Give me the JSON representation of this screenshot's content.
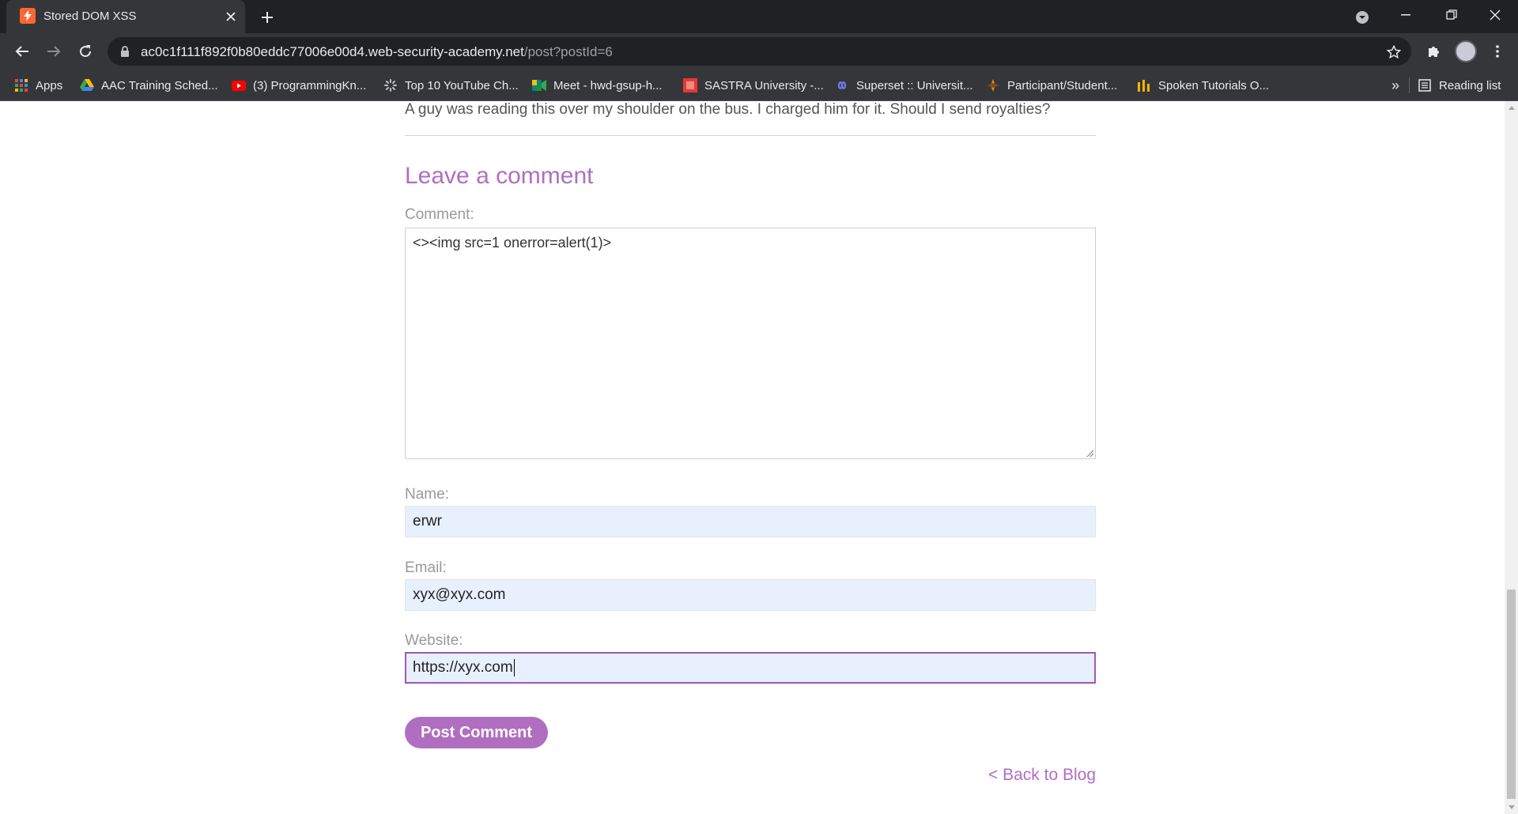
{
  "browser": {
    "tab": {
      "title": "Stored DOM XSS"
    },
    "url": {
      "host": "ac0c1f111f892f0b80eddc77006e00d4.web-security-academy.net",
      "path": "/post?postId=6"
    },
    "bookmarks": [
      {
        "label": "Apps",
        "icon": "apps-grid-icon"
      },
      {
        "label": "AAC Training Sched...",
        "icon": "google-drive-icon"
      },
      {
        "label": "(3) ProgrammingKn...",
        "icon": "youtube-icon"
      },
      {
        "label": "Top 10 YouTube Ch...",
        "icon": "loading-spinner-icon"
      },
      {
        "label": "Meet - hwd-gsup-h...",
        "icon": "google-meet-icon"
      },
      {
        "label": "SASTRA University -...",
        "icon": "sastra-icon"
      },
      {
        "label": "Superset :: Universit...",
        "icon": "superset-icon"
      },
      {
        "label": "Participant/Student...",
        "icon": "participant-icon"
      },
      {
        "label": "Spoken Tutorials O...",
        "icon": "spoken-tutorials-icon"
      }
    ],
    "overflow_label": "»",
    "reading_list_label": "Reading list"
  },
  "page": {
    "previous_comment": "A guy was reading this over my shoulder on the bus. I charged him for it. Should I send royalties?",
    "form": {
      "title": "Leave a comment",
      "comment_label": "Comment:",
      "comment_value": "<><img src=1 onerror=alert(1)>",
      "name_label": "Name:",
      "name_value": "erwr",
      "email_label": "Email:",
      "email_value": "xyx@xyx.com",
      "website_label": "Website:",
      "website_value": "https://xyx.com",
      "submit_label": "Post Comment"
    },
    "back_link": "< Back to Blog"
  },
  "colors": {
    "accent": "#b06ec0",
    "chrome_dark": "#202124",
    "chrome_toolbar": "#35363a",
    "autofill_bg": "#e8f0fe"
  }
}
